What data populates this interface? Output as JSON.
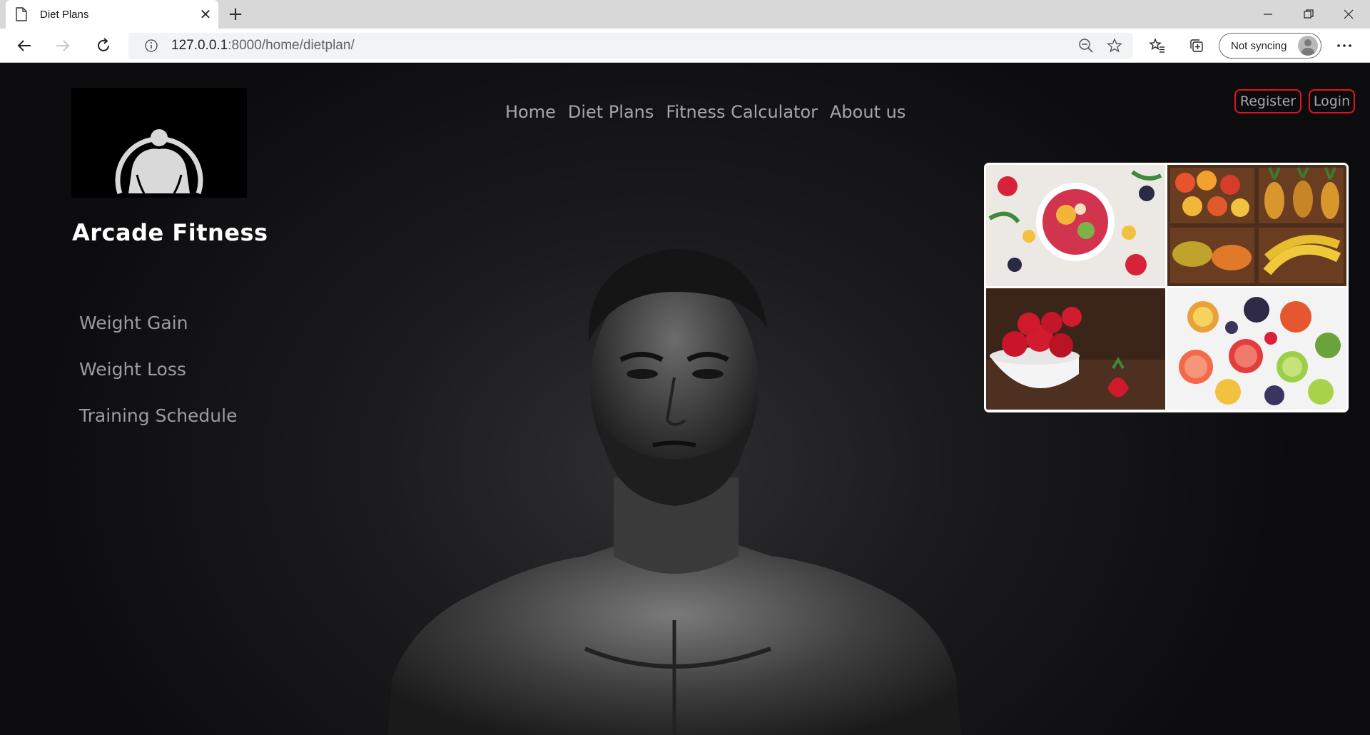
{
  "browser": {
    "tab_title": "Diet Plans",
    "url_host": "127.0.0.1",
    "url_rest": ":8000/home/dietplan/",
    "sync_label": "Not syncing"
  },
  "site": {
    "brand": "Arcade Fitness",
    "nav": [
      "Home",
      "Diet Plans",
      "Fitness Calculator",
      "About us"
    ],
    "register_label": "Register",
    "login_label": "Login",
    "sidebar": [
      "Weight Gain",
      "Weight Loss",
      "Training Schedule"
    ]
  },
  "colors": {
    "accent_border": "#e0141e",
    "page_bg": "#0d0d0f",
    "nav_text": "#a6a6a6"
  },
  "icons": [
    "document-icon",
    "close-icon",
    "plus-icon",
    "minimize-icon",
    "restore-icon",
    "window-close-icon",
    "back-arrow-icon",
    "forward-arrow-icon",
    "refresh-icon",
    "info-icon",
    "zoom-out-icon",
    "star-icon",
    "favorites-icon",
    "collections-icon",
    "profile-icon",
    "more-icon",
    "bodybuilder-logo-icon"
  ]
}
